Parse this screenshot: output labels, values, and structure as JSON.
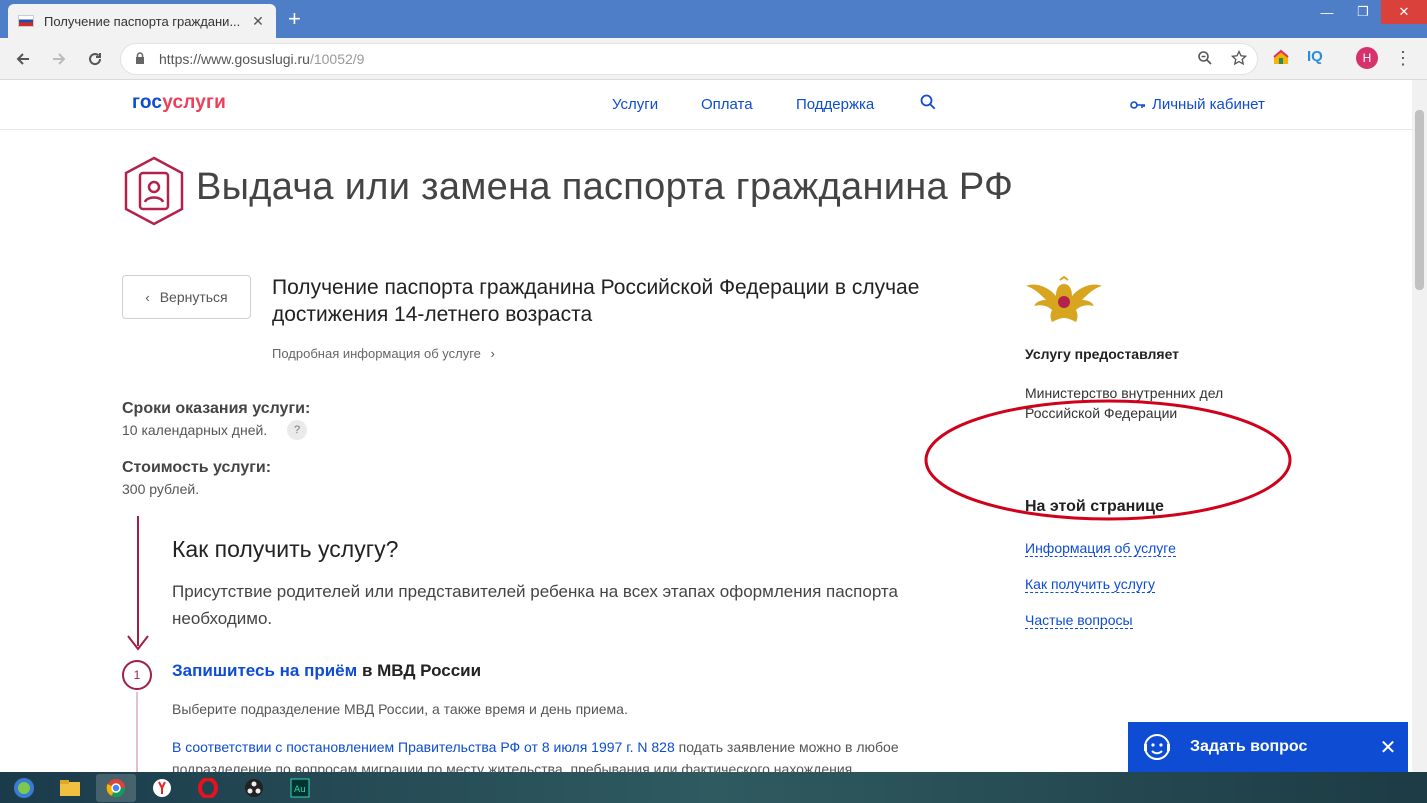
{
  "browser": {
    "tab_title": "Получение паспорта граждани...",
    "tab_close": "✕",
    "new_tab": "+",
    "url_base": "https://www.gosuslugi.ru",
    "url_path": "/10052/9",
    "ext_iq": "IQ",
    "avatar_letter": "Н",
    "window_controls": [
      "—",
      "❐",
      "✕"
    ]
  },
  "header": {
    "logo_gos": "гос",
    "logo_uslugi": "услуги",
    "nav": [
      "Услуги",
      "Оплата",
      "Поддержка"
    ],
    "cabinet": "Личный кабинет"
  },
  "page": {
    "title": "Выдача или замена паспорта гражданина РФ",
    "back": "Вернуться",
    "service_title": "Получение паспорта гражданина Российской Федерации в случае достижения 14-летнего возраста",
    "more_info": "Подробная информация об услуге",
    "term_label": "Сроки оказания услуги:",
    "term_value": "10 календарных дней.",
    "term_help": "?",
    "cost_label": "Стоимость услуги:",
    "cost_value": "300 рублей.",
    "how_title": "Как получить услугу?",
    "how_text": "Присутствие родителей или представителей ребенка на всех этапах оформления паспорта необходимо.",
    "step_number": "1",
    "step_link": "Запишитесь на приём",
    "step_rest": " в МВД России",
    "step_desc": "Выберите подразделение МВД России, а также время и день приема.",
    "step_note_link": "В соответствии с постановлением Правительства РФ от 8 июля 1997 г. N 828",
    "step_note_rest": " подать заявление можно в любое подразделение по вопросам миграции по месту жительства, пребывания или фактического нахождения."
  },
  "sidebar": {
    "provider_label": "Услугу предоставляет",
    "provider": "Министерство внутренних дел Российской Федерации",
    "onpage_label": "На этой странице",
    "anchors": [
      "Информация об услуге",
      "Как получить услугу",
      "Частые вопросы"
    ]
  },
  "ask": {
    "label": "Задать вопрос",
    "close": "✕"
  },
  "colors": {
    "brand_blue": "#0d4cd3",
    "brand_red": "#ee3f58",
    "accent_maroon": "#a01f45",
    "annotation_red": "#d0021b"
  }
}
